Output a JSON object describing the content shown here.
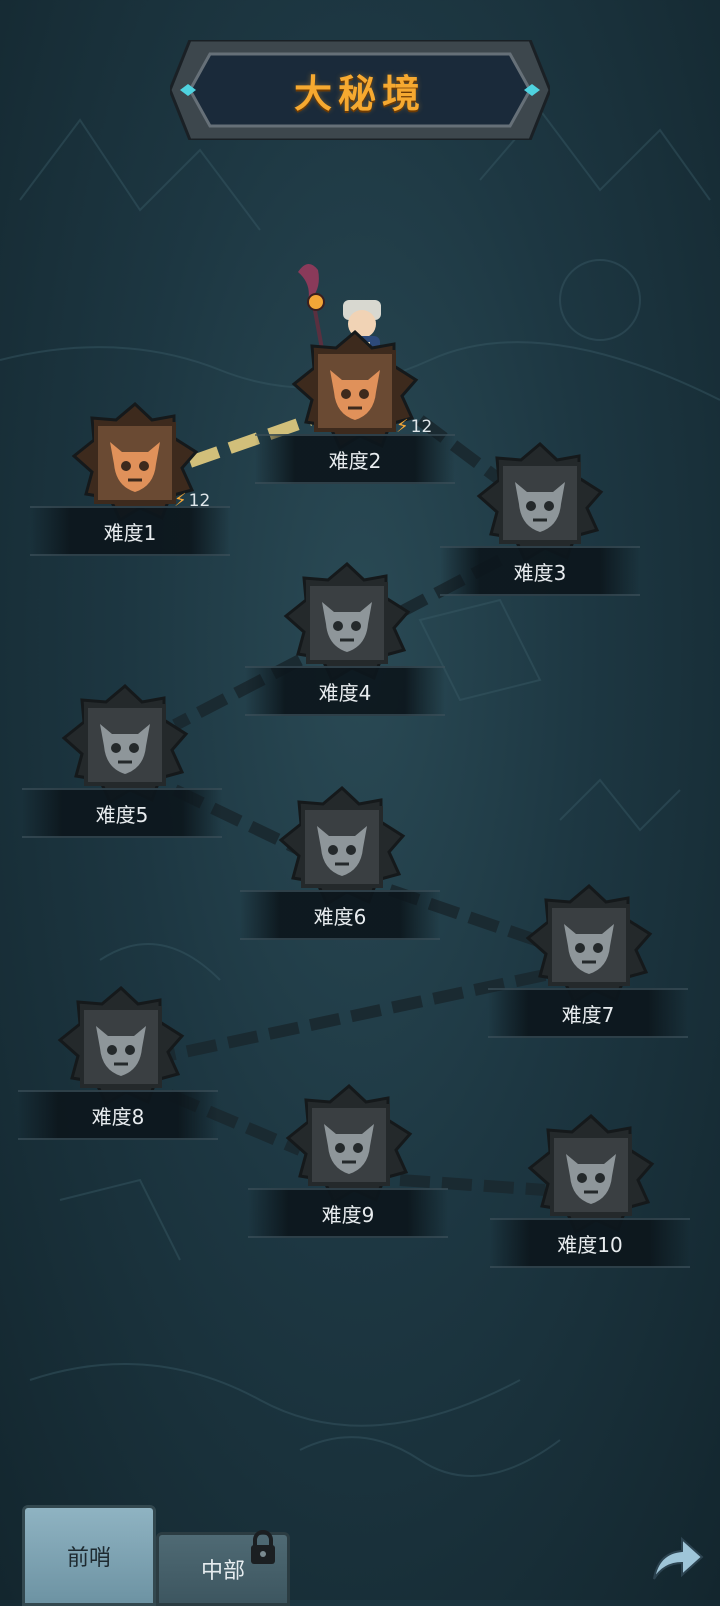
{
  "title": "大秘境",
  "colors": {
    "title": "#f6a930",
    "unlocked_node": "#6a4a33",
    "locked_node": "#3a3f42",
    "path_done": "#d1bf7a",
    "path_locked": "#1a2a31"
  },
  "nodes": [
    {
      "label": "难度1",
      "state": "unlocked",
      "energy": "12"
    },
    {
      "label": "难度2",
      "state": "unlocked",
      "energy": "12"
    },
    {
      "label": "难度3",
      "state": "locked"
    },
    {
      "label": "难度4",
      "state": "locked"
    },
    {
      "label": "难度5",
      "state": "locked"
    },
    {
      "label": "难度6",
      "state": "locked"
    },
    {
      "label": "难度7",
      "state": "locked"
    },
    {
      "label": "难度8",
      "state": "locked"
    },
    {
      "label": "难度9",
      "state": "locked"
    },
    {
      "label": "难度10",
      "state": "locked"
    }
  ],
  "tabs": [
    {
      "label": "前哨",
      "active": true,
      "locked": false
    },
    {
      "label": "中部",
      "active": false,
      "locked": true
    }
  ],
  "icons": {
    "energy": "lightning-bolt-icon",
    "lock": "padlock-icon",
    "share": "share-arrow-icon",
    "node": "demon-skull-icon"
  }
}
